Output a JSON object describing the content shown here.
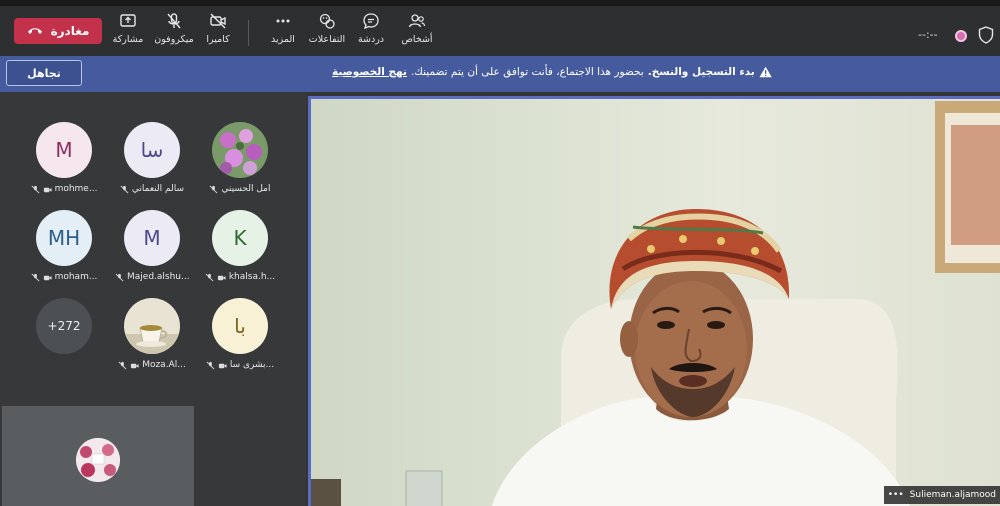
{
  "toolbar": {
    "leave_label": "مغادرة",
    "share_label": "مشاركة",
    "mic_label": "ميكروفون",
    "camera_label": "كاميرا",
    "more_label": "المزيد",
    "reactions_label": "التفاعلات",
    "chat_label": "دردشة",
    "people_label": "أشخاص",
    "timer": "--:--",
    "leave_color": "#c4314b"
  },
  "banner": {
    "dismiss_label": "تجاهل",
    "bold_text": "بدء التسجيل والنسخ.",
    "text": "بحضور هذا الاجتماع، فأنت توافق على أن يتم تضمينك.",
    "link_text": "نهج الخصوصية",
    "background": "#465b9e"
  },
  "participants": [
    {
      "initials": "",
      "name": "أمل الحسيني",
      "photo": "flowers"
    },
    {
      "initials": "سا",
      "name": "سالم النعماني"
    },
    {
      "initials": "M",
      "name": "mohme..."
    },
    {
      "initials": "K",
      "name": "khalsa.h..."
    },
    {
      "initials": "M",
      "name": "Majed.alshu..."
    },
    {
      "initials": "MH",
      "name": "moham..."
    },
    {
      "initials": "با",
      "name": "بشرى سا..."
    },
    {
      "initials": "",
      "name": "Moza.Al...",
      "photo": "cup"
    },
    {
      "initials": "+272",
      "name": ""
    }
  ],
  "main_video": {
    "speaker_name": "Sulieman.aljamood",
    "more_icon": "ellipsis-icon"
  }
}
